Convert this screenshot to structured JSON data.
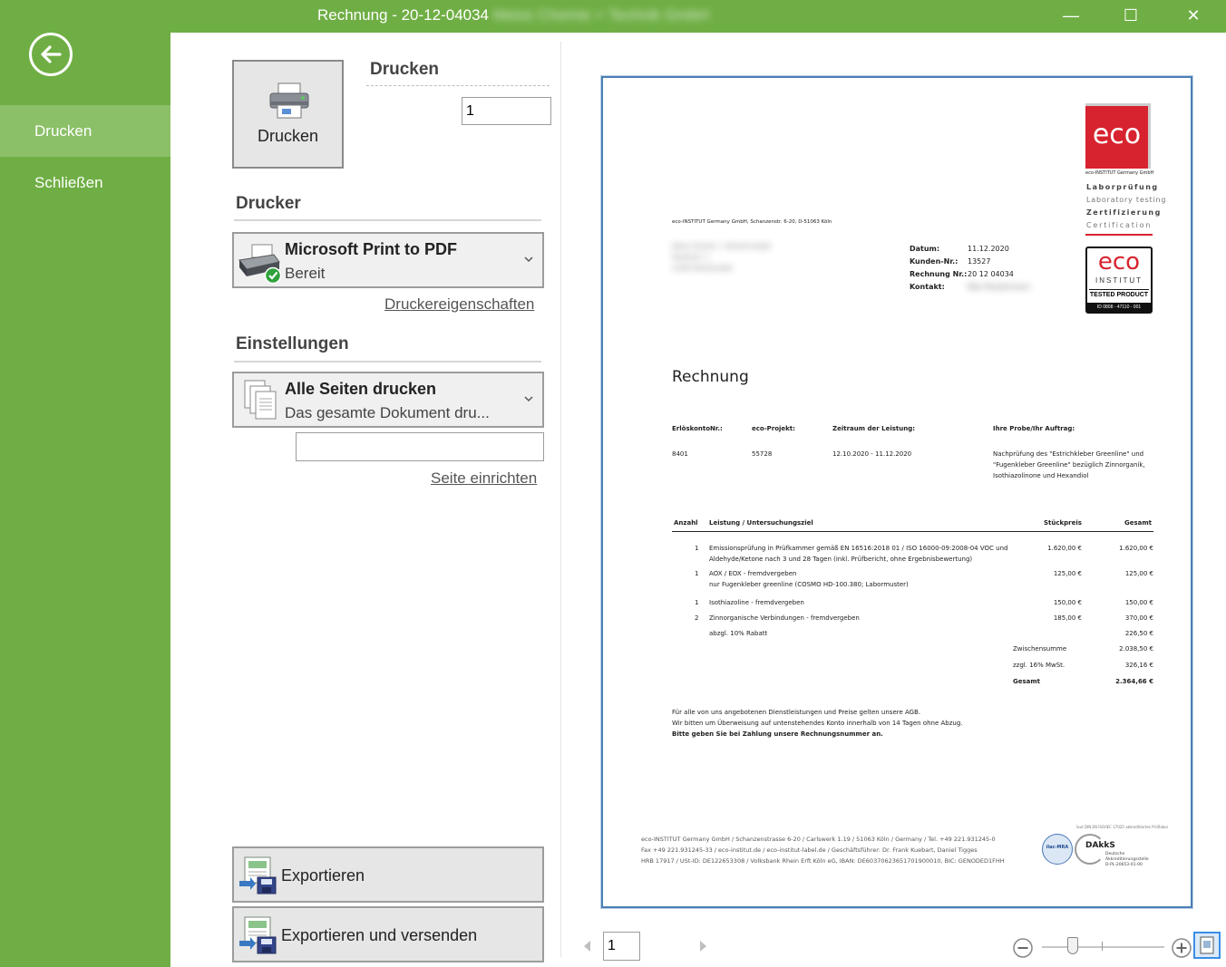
{
  "window": {
    "title": "Rechnung - 20-12-04034",
    "title_company": "Meiss Chemie + Technik GmbH",
    "minimize_glyph": "—",
    "maximize_glyph": "☐",
    "close_glyph": "✕"
  },
  "sidebar": {
    "items": [
      {
        "label": "Drucken",
        "selected": true
      },
      {
        "label": "Schließen",
        "selected": false
      }
    ]
  },
  "print": {
    "button_label": "Drucken",
    "section_title": "Drucken",
    "copies": "1",
    "printer_section": "Drucker",
    "printer_name": "Microsoft Print to PDF",
    "printer_status": "Bereit",
    "printer_props_link": "Druckereigenschaften",
    "settings_section": "Einstellungen",
    "pages_option_title": "Alle Seiten drucken",
    "pages_option_desc": "Das gesamte Dokument dru...",
    "page_range_value": "",
    "page_setup_link": "Seite einrichten",
    "export_label": "Exportieren",
    "export_send_label": "Exportieren und versenden"
  },
  "preview": {
    "page_number": "1",
    "zoom_level": 0.25
  },
  "invoice": {
    "sender_line": "eco-INSTITUT Germany GmbH, Schanzenstr. 6-20, D-51063 Köln",
    "logo_text": "eco",
    "logo_company": "eco-INSTITUT Germany GmbH",
    "tag_lines": [
      "Laborprüfung",
      "Laboratory testing",
      "Zertifizierung",
      "Certification"
    ],
    "badge_top": "eco",
    "badge_institut": "INSTITUT",
    "badge_tested": "TESTED PRODUCT",
    "badge_id": "ID 0808 - 47110 - 001",
    "address_lines": [
      "Meiss Chemie + Technik GmbH",
      "Musterstr. 1",
      "12345 Musterstadt"
    ],
    "meta": [
      {
        "label": "Datum:",
        "value": "11.12.2020"
      },
      {
        "label": "Kunden-Nr.:",
        "value": "13527"
      },
      {
        "label": "Rechnung Nr.:",
        "value": "20 12 04034"
      },
      {
        "label": "Kontakt:",
        "value": "Max Mustermann"
      }
    ],
    "heading": "Rechnung",
    "info_headers": [
      "ErlöskontoNr.:",
      "eco-Projekt:",
      "Zeitraum der Leistung:",
      "Ihre Probe/Ihr Auftrag:"
    ],
    "info_values": [
      "8401",
      "55728",
      "12.10.2020 - 11.12.2020"
    ],
    "info_sample": [
      "Nachprüfung des \"Estrichkleber Greenline\" und",
      "\"Fugenkleber Greenline\" bezüglich Zinnorganik,",
      "Isothiazolinone und Hexandiol"
    ],
    "table_headers": [
      "Anzahl",
      "Leistung / Untersuchungsziel",
      "Stückpreis",
      "Gesamt"
    ],
    "rows": [
      {
        "qty": "1",
        "desc": [
          "Emissionsprüfung in Prüfkammer gemäß EN 16516:2018 01 / ISO 16000-09:2008-04 VOC und",
          "Aldehyde/Ketone nach 3 und 28 Tagen (inkl. Prüfbericht, ohne Ergebnisbewertung)"
        ],
        "price": "1.620,00 €",
        "total": "1.620,00 €"
      },
      {
        "qty": "1",
        "desc": [
          "AOX / EOX - fremdvergeben",
          "nur Fugenkleber greenline (COSMO HD-100.380; Labormuster)"
        ],
        "price": "125,00 €",
        "total": "125,00 €"
      },
      {
        "qty": "1",
        "desc": [
          "Isothiazoline - fremdvergeben"
        ],
        "price": "150,00 €",
        "total": "150,00 €"
      },
      {
        "qty": "2",
        "desc": [
          "Zinnorganische Verbindungen - fremdvergeben"
        ],
        "price": "185,00 €",
        "total": "370,00 €"
      }
    ],
    "discount_label": "abzgl. 10% Rabatt",
    "discount_value": "226,50 €",
    "subtotal_label": "Zwischensumme",
    "subtotal_value": "2.038,50 €",
    "vat_label": "zzgl. 16% MwSt.",
    "vat_value": "326,16 €",
    "total_label": "Gesamt",
    "total_value": "2.364,66 €",
    "note_lines": [
      "Für alle von uns angebotenen Dienstleistungen und Preise gelten unsere AGB.",
      "Wir bitten um Überweisung auf untenstehendes Konto innerhalb von 14 Tagen ohne Abzug."
    ],
    "note_bold": "Bitte geben Sie bei Zahlung unsere Rechnungsnummer an.",
    "footer_lines": [
      "eco-INSTITUT Germany GmbH / Schanzenstrasse 6-20 / Carlswerk 1.19 / 51063 Köln / Germany / Tel. +49 221.931245-0",
      "Fax +49 221.931245-33 / eco-institut.de / eco-institut-label.de / Geschäftsführer: Dr. Frank Kuebart, Daniel Tigges",
      "HRB 17917 / USt-ID: DE122653308 / Volksbank Rhein Erft Köln eG, IBAN: DE60370623651701900010, BIC: GENODED1FHH"
    ],
    "dakks_label": "DAkkS",
    "dakks_sub": [
      "Deutsche",
      "Akkreditierungsstelle",
      "D-PL-20653-01-00"
    ],
    "ilac_label": "ilac-MRA",
    "accred_note": "laut DIN EN ISO/IEC 17025 akkreditiertes Prüflabor"
  },
  "colors": {
    "brand_green": "#6fae44",
    "sidebar_selected": "#8cc068",
    "eco_red": "#d7232f",
    "preview_border": "#4b7fb5"
  }
}
